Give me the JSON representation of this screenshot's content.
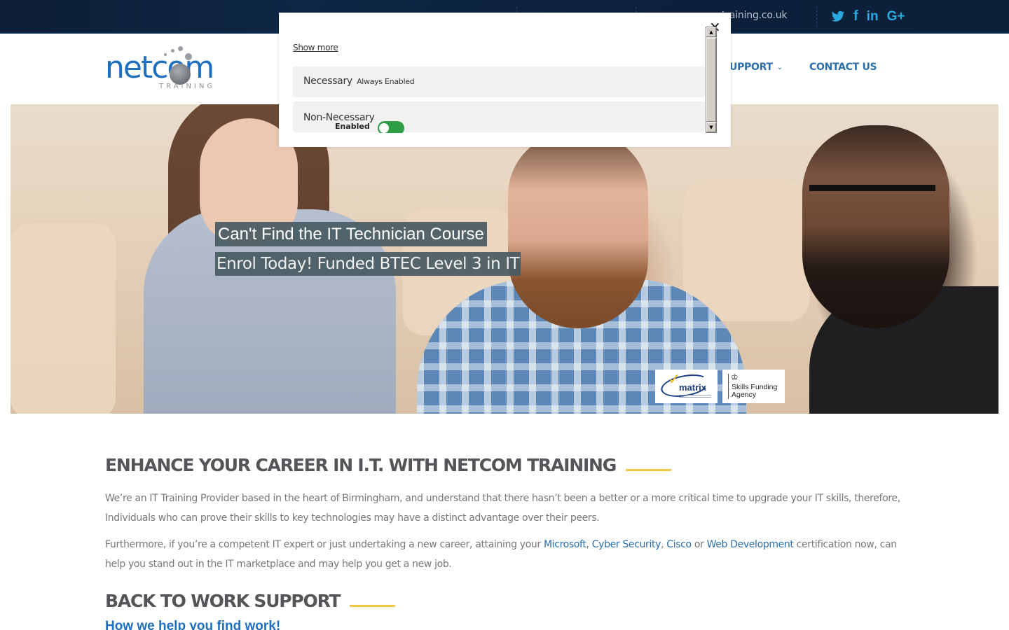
{
  "topbar": {
    "email_partial": "training.co.uk",
    "social": [
      {
        "icon": "twitter-icon",
        "glyph": ""
      },
      {
        "icon": "facebook-icon",
        "glyph": "f"
      },
      {
        "icon": "linkedin-icon",
        "glyph": "in"
      },
      {
        "icon": "google-plus-icon",
        "glyph": "G+"
      }
    ]
  },
  "header": {
    "logo": {
      "word": "netcom",
      "sub": "TRAINING"
    },
    "nav": {
      "support_label": "UPPORT",
      "support_chevron": "⌄",
      "contact_label": "CONTACT US"
    }
  },
  "hero": {
    "title": "Can't Find the IT Technician Course",
    "subtitle": "Enrol Today! Funded BTEC Level 3 in IT",
    "badges": {
      "matrix": "matrix",
      "sfa_line1": "Skills Funding",
      "sfa_line2": "Agency"
    }
  },
  "content": {
    "section1_title": "ENHANCE YOUR CAREER IN I.T. WITH NETCOM TRAINING",
    "para1": "We’re an IT Training Provider based in the heart of Birmingham, and understand that there hasn’t been a better or a more critical time to upgrade your IT skills, therefore, Individuals who can prove their skills to key technologies may have a distinct advantage over their peers.",
    "para2": {
      "before": "Furthermore, if you’re a competent IT expert or just undertaking a new career, attaining your ",
      "link_microsoft": "Microsoft",
      "sep1": ", ",
      "link_cyber": "Cyber Security",
      "sep2": ", ",
      "link_cisco": "Cisco",
      "sep3": " or ",
      "link_web": "Web Development",
      "after": " certification now, can help you stand out in the IT marketplace and may help you get a new job."
    },
    "section2_title": "BACK TO WORK SUPPORT",
    "subhead": "How we help you find work!"
  },
  "cookie_modal": {
    "close": "×",
    "show_more": "Show more",
    "categories": [
      {
        "name": "Necessary",
        "status": "Always Enabled"
      },
      {
        "name": "Non-Necessary",
        "status": "Enabled",
        "toggle_on": true
      }
    ],
    "scroll_up": "▲",
    "scroll_down": "▼"
  },
  "colors": {
    "topbar_bg": "#0e2440",
    "brand_blue": "#1e6fbf",
    "nav_link": "#2b6ea8",
    "social": "#29a9e0",
    "heading": "#555559",
    "accent_underline": "#f2c744",
    "body_text": "#777777",
    "toggle_on": "#2e9e45"
  }
}
